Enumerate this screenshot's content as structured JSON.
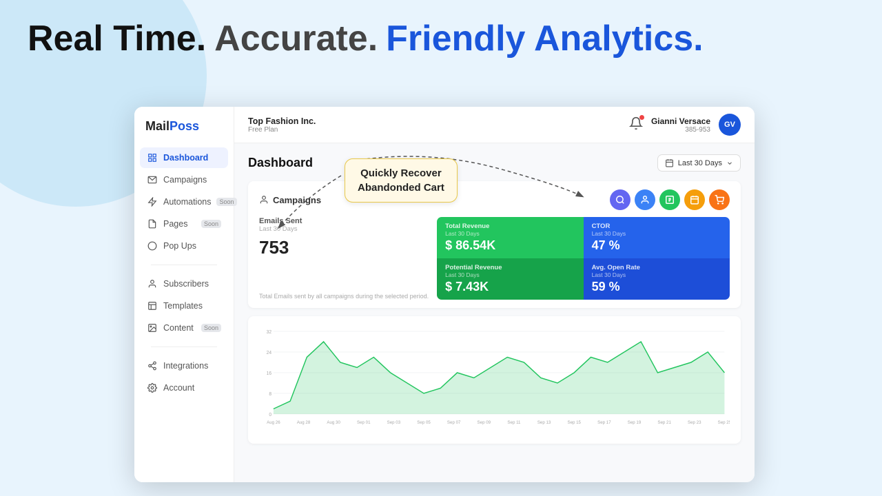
{
  "hero": {
    "part1": "Real Time.",
    "part2": "Accurate.",
    "part3": "Friendly Analytics."
  },
  "topbar": {
    "company": "Top Fashion Inc.",
    "plan": "Free Plan",
    "bell_icon": "🔔",
    "user_name": "Gianni Versace",
    "user_id": "385-953",
    "user_initials": "GV"
  },
  "sidebar": {
    "logo_mail": "Mail",
    "logo_poss": "Poss",
    "items": [
      {
        "id": "dashboard",
        "label": "Dashboard",
        "icon": "grid",
        "active": true,
        "soon": false
      },
      {
        "id": "campaigns",
        "label": "Campaigns",
        "icon": "mail",
        "active": false,
        "soon": false
      },
      {
        "id": "automations",
        "label": "Automations",
        "icon": "zap",
        "active": false,
        "soon": true
      },
      {
        "id": "pages",
        "label": "Pages",
        "icon": "file",
        "active": false,
        "soon": true
      },
      {
        "id": "popups",
        "label": "Pop Ups",
        "icon": "circle",
        "active": false,
        "soon": false
      },
      {
        "id": "subscribers",
        "label": "Subscribers",
        "icon": "user",
        "active": false,
        "soon": false
      },
      {
        "id": "templates",
        "label": "Templates",
        "icon": "layout",
        "active": false,
        "soon": false
      },
      {
        "id": "content",
        "label": "Content",
        "icon": "image",
        "active": false,
        "soon": true
      },
      {
        "id": "integrations",
        "label": "Integrations",
        "icon": "share",
        "active": false,
        "soon": false
      },
      {
        "id": "account",
        "label": "Account",
        "icon": "settings",
        "active": false,
        "soon": false
      }
    ]
  },
  "dashboard": {
    "title": "Dashboard",
    "date_range": "Last 30 Days",
    "campaigns_section": {
      "title": "Campaigns",
      "emails_sent_label": "Emails Sent",
      "emails_sent_sublabel": "Last 30 Days",
      "emails_sent_count": "753",
      "emails_sent_desc": "Total Emails sent by all campaigns during the selected period.",
      "metrics": [
        {
          "label": "Total Revenue",
          "sublabel": "Last 30 Days",
          "value": "$ 86.54K",
          "color": "green"
        },
        {
          "label": "CTOR",
          "sublabel": "Last 30 Days",
          "value": "47 %",
          "color": "blue"
        },
        {
          "label": "Potential Revenue",
          "sublabel": "Last 30 Days",
          "value": "$ 7.43K",
          "color": "green2"
        },
        {
          "label": "Avg. Open Rate",
          "sublabel": "Last 30 Days",
          "value": "59 %",
          "color": "blue2"
        }
      ]
    },
    "chart": {
      "x_labels": [
        "Aug 26",
        "Aug 28",
        "Aug 30",
        "Sep 01",
        "Sep 03",
        "Sep 05",
        "Sep 07",
        "Sep 09",
        "Sep 11",
        "Sep 13",
        "Sep 15",
        "Sep 17",
        "Sep 19",
        "Sep 21",
        "Sep 23",
        "Sep 25"
      ],
      "y_labels": [
        "0",
        "8",
        "16",
        "24",
        "32"
      ]
    }
  },
  "callout": {
    "line1": "Quickly Recover",
    "line2": "Abandonded Cart"
  },
  "campaign_icon_colors": [
    "#6366f1",
    "#3b82f6",
    "#22c55e",
    "#f59e0b",
    "#f97316"
  ]
}
